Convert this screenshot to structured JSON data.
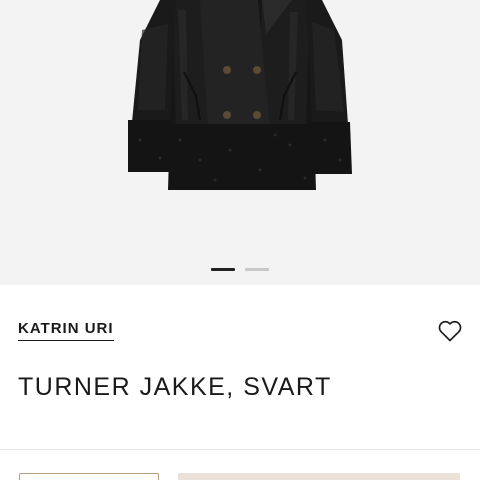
{
  "product": {
    "brand": "KATRIN URI",
    "title": "TURNER JAKKE, SVART",
    "image_alt_icon": "black-shearling-jacket",
    "gallery": {
      "total_images": 2,
      "active_index": 0
    }
  },
  "actions": {
    "favorite_icon": "heart-outline-icon",
    "size_select_value": "",
    "add_to_cart_label": ""
  },
  "colors": {
    "gallery_background": "#f3f3f3",
    "active_dot": "#222222",
    "inactive_dot": "#c8c8c8",
    "accent_border": "#b79f80",
    "cart_button_bg": "#eae2d8"
  }
}
